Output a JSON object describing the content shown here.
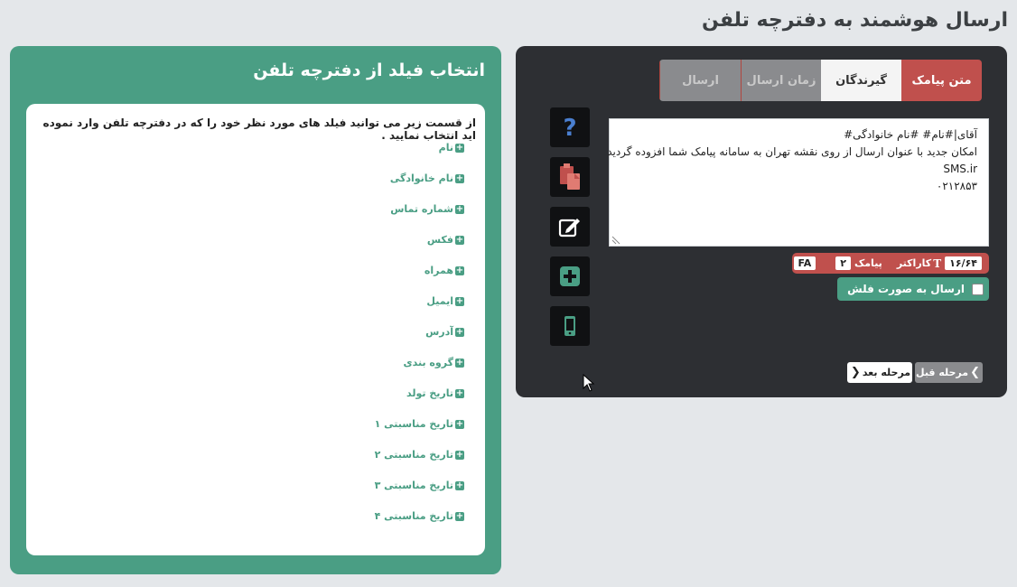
{
  "page": {
    "title": "ارسال هوشمند به دفترچه تلفن"
  },
  "tabs": [
    {
      "label": "متن پیامک"
    },
    {
      "label": "گیرندگان"
    },
    {
      "label": "زمان ارسال"
    },
    {
      "label": "ارسال"
    }
  ],
  "tools": [
    "help-icon",
    "paste-icon",
    "edit-icon",
    "add-icon",
    "mobile-icon"
  ],
  "message": {
    "lines": [
      "آقای|#نام# #نام خانوادگی#",
      "امکان جدید با عنوان ارسال از روی نقشه تهران به سامانه پیامک شما افزوده گردید",
      "SMS.ir",
      "۰۲۱۲۸۵۳"
    ]
  },
  "counter": {
    "chars_value": "۱۶/۶۴",
    "chars_label": "کاراکتر",
    "sms_value": "۲",
    "sms_label": "پیامک",
    "lang": "FA"
  },
  "flash": {
    "label": "ارسال به صورت فلش"
  },
  "nav": {
    "prev_label": "مرحله قبل",
    "next_label": "مرحله بعد"
  },
  "fields_panel": {
    "title": "انتخاب فیلد از دفترچه تلفن",
    "intro": "از قسمت زیر می توانید فیلد های مورد نظر خود را که در دفترچه تلفن وارد نموده اید انتخاب نمایید .",
    "items": [
      "نام",
      "نام خانوادگی",
      "شماره تماس",
      "فکس",
      "همراه",
      "ایمیل",
      "آدرس",
      "گروه بندی",
      "تاریخ تولد",
      "تاریخ مناسبتی ۱",
      "تاریخ مناسبتی ۲",
      "تاریخ مناسبتی ۳",
      "تاریخ مناسبتی ۴"
    ]
  },
  "colors": {
    "accent_red": "#c0504d",
    "accent_green": "#4a9e84",
    "dark_panel": "#2d2f33"
  }
}
